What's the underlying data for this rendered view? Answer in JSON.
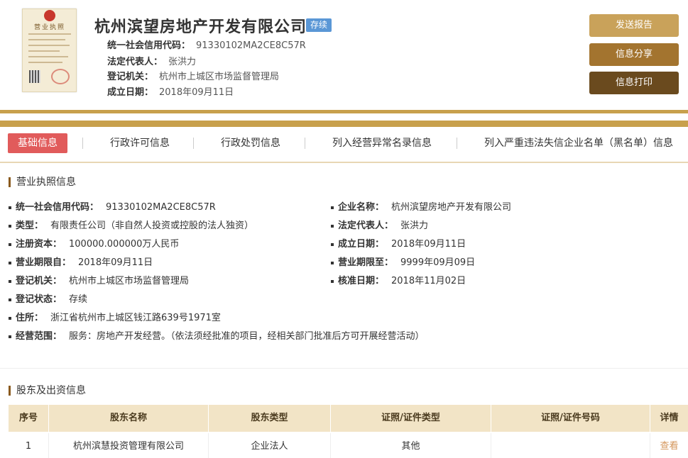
{
  "header": {
    "company_name": "杭州滨望房地产开发有限公司",
    "status_tag": "存续",
    "credit_code_label": "统一社会信用代码：",
    "credit_code": "91330102MA2CE8C57R",
    "legal_rep_label": "法定代表人：",
    "legal_rep": "张洪力",
    "reg_authority_label": "登记机关：",
    "reg_authority": "杭州市上城区市场监督管理局",
    "founded_label": "成立日期：",
    "founded": "2018年09月11日",
    "license_title": "营业执照",
    "buttons": {
      "report": "发送报告",
      "share": "信息分享",
      "print": "信息打印"
    }
  },
  "tabs": [
    {
      "label": "基础信息",
      "active": true
    },
    {
      "label": "行政许可信息",
      "active": false
    },
    {
      "label": "行政处罚信息",
      "active": false
    },
    {
      "label": "列入经营异常名录信息",
      "active": false
    },
    {
      "label": "列入严重违法失信企业名单（黑名单）信息",
      "active": false
    }
  ],
  "license_section": {
    "title": "营业执照信息",
    "left": [
      {
        "label": "统一社会信用代码：",
        "value": "91330102MA2CE8C57R"
      },
      {
        "label": "类型：",
        "value": "有限责任公司（非自然人投资或控股的法人独资）"
      },
      {
        "label": "注册资本：",
        "value": "100000.000000万人民币"
      },
      {
        "label": "营业期限自：",
        "value": "2018年09月11日"
      },
      {
        "label": "登记机关：",
        "value": "杭州市上城区市场监督管理局"
      },
      {
        "label": "登记状态：",
        "value": "存续"
      },
      {
        "label": "住所：",
        "value": "浙江省杭州市上城区钱江路639号1971室"
      },
      {
        "label": "经营范围：",
        "value": "服务：房地产开发经营。（依法须经批准的项目，经相关部门批准后方可开展经营活动）"
      }
    ],
    "right": [
      {
        "label": "企业名称：",
        "value": "杭州滨望房地产开发有限公司"
      },
      {
        "label": "法定代表人：",
        "value": "张洪力"
      },
      {
        "label": "成立日期：",
        "value": "2018年09月11日"
      },
      {
        "label": "营业期限至：",
        "value": "9999年09月09日"
      },
      {
        "label": "核准日期：",
        "value": "2018年11月02日"
      }
    ]
  },
  "shareholder_section": {
    "title": "股东及出资信息",
    "columns": [
      "序号",
      "股东名称",
      "股东类型",
      "证照/证件类型",
      "证照/证件号码",
      "详情"
    ],
    "rows": [
      [
        "1",
        "杭州滨慧投资管理有限公司",
        "企业法人",
        "其他",
        "",
        "查看"
      ]
    ]
  },
  "colors": {
    "gold": "#c8a04c",
    "active_tab": "#e15b5b",
    "status_tag": "#5a97d6",
    "link": "#d4955a"
  }
}
